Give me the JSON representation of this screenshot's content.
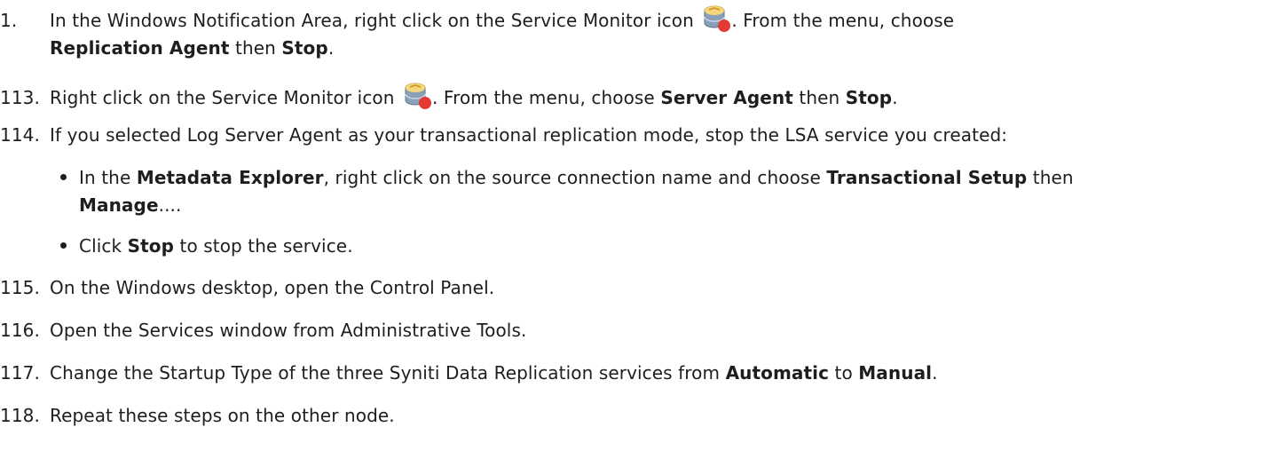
{
  "steps": [
    {
      "num": "1.",
      "l1_a": "In the Windows Notification Area, right click on the Service Monitor icon",
      "l1_b": ". From the menu, choose",
      "l2_a": "Replication Agent",
      "l2_b": " then ",
      "l2_c": "Stop",
      "l2_d": "."
    },
    {
      "num": "113.",
      "a": "Right click on the Service Monitor icon",
      "b": ". From the menu, choose ",
      "c": "Server Agent",
      "d": " then ",
      "e": "Stop",
      "f": "."
    },
    {
      "num": "114.",
      "a": "If you selected Log Server Agent as your transactional replication mode, stop the LSA service you created:"
    },
    {
      "bullet1_a": "In the ",
      "bullet1_b": "Metadata Explorer",
      "bullet1_c": ", right click on the source connection name and choose ",
      "bullet1_d": "Transactional Setup",
      "bullet1_e": " then",
      "bullet1_f": "Manage",
      "bullet1_g": "....",
      "bullet2_a": "Click ",
      "bullet2_b": "Stop",
      "bullet2_c": " to stop the service."
    },
    {
      "num": "115.",
      "a": "On the Windows desktop, open the Control Panel."
    },
    {
      "num": "116.",
      "a": "Open the Services window from Administrative Tools."
    },
    {
      "num": "117.",
      "a": "Change the Startup Type of the three Syniti Data Replication services from ",
      "b": "Automatic",
      "c": " to ",
      "d": "Manual",
      "e": "."
    },
    {
      "num": "118.",
      "a": "Repeat these steps on the other node."
    }
  ],
  "icons": {
    "service_monitor": "service-monitor-icon",
    "colors": {
      "db_top": "#f2d16b",
      "db_body": "#8a9fb8",
      "stop_dot": "#e53935"
    }
  }
}
